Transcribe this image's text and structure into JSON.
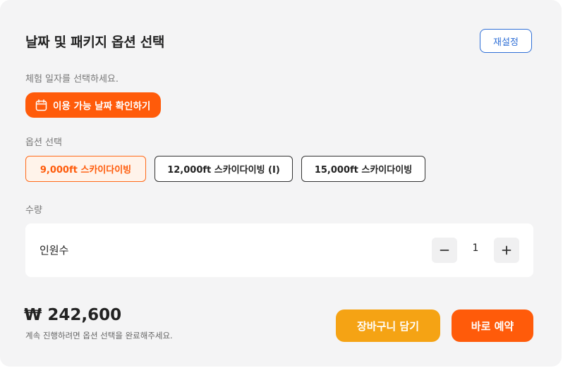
{
  "header": {
    "title": "날짜 및 패키지 옵션 선택",
    "reset_label": "재설정"
  },
  "date": {
    "instruction": "체험 일자를 선택하세요.",
    "check_button_label": "이용 가능 날짜 확인하기",
    "check_button_icon": "calendar-icon"
  },
  "options": {
    "section_label": "옵션 선택",
    "items": [
      {
        "label": "9,000ft 스카이다이빙",
        "selected": true
      },
      {
        "label": "12,000ft 스카이다이빙 (I)",
        "selected": false
      },
      {
        "label": "15,000ft 스카이다이빙",
        "selected": false
      }
    ]
  },
  "quantity": {
    "section_label": "수량",
    "row_label": "인원수",
    "value": "1",
    "decrement_icon": "minus-icon",
    "increment_icon": "plus-icon"
  },
  "footer": {
    "price": "₩ 242,600",
    "hint": "계속 진행하려면 옵션 선택을 완료해주세요.",
    "cart_label": "장바구니 담기",
    "book_label": "바로 예약"
  },
  "colors": {
    "accent_orange": "#ff5b0a",
    "cart_yellow": "#f5a314",
    "reset_blue": "#2f6fd6",
    "panel_bg": "#f4f4f5"
  }
}
